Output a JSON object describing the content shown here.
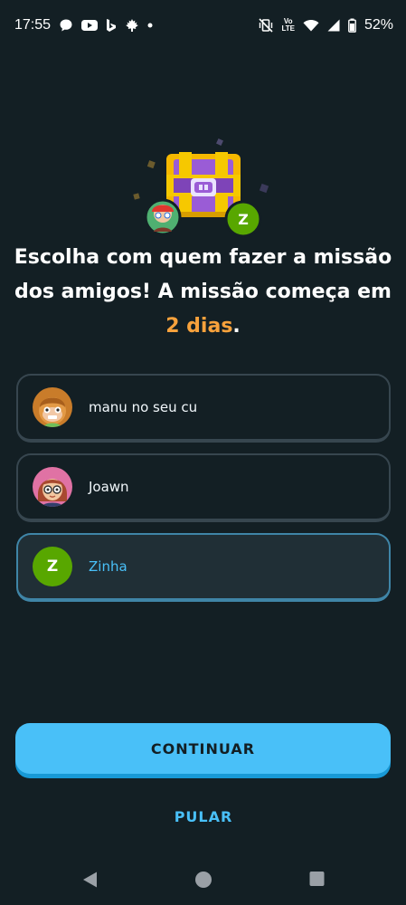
{
  "status_bar": {
    "time": "17:55",
    "battery_percent": "52%",
    "network_label_top": "Vo",
    "network_label_bottom": "LTE",
    "left_icons": [
      "chat-bubble-icon",
      "youtube-icon",
      "bing-icon",
      "maple-leaf-icon",
      "dot-icon"
    ],
    "right_icons": [
      "vibrate-off-icon",
      "volte-icon",
      "wifi-icon",
      "signal-icon",
      "battery-icon"
    ]
  },
  "hero": {
    "friend_avatar_letter": "Z"
  },
  "heading": {
    "part1": "Escolha com quem fazer a missão dos amigos! A missão começa em ",
    "highlight": "2 dias",
    "part2": "."
  },
  "friends": [
    {
      "name": "manu no seu cu",
      "avatar": "avatar-monkey",
      "selected": false
    },
    {
      "name": "Joawn",
      "avatar": "avatar-girl-glasses",
      "selected": false
    },
    {
      "name": "Zinha",
      "avatar_letter": "Z",
      "selected": true
    }
  ],
  "buttons": {
    "continue": "CONTINUAR",
    "skip": "PULAR"
  },
  "colors": {
    "background": "#131f24",
    "accent_blue": "#49c0f8",
    "accent_orange": "#f8a23c",
    "option_border": "#37464f",
    "selected_border": "#3f85a7",
    "avatar_green": "#58a700"
  },
  "nav_bar": [
    "back-icon",
    "home-icon",
    "recents-icon"
  ]
}
